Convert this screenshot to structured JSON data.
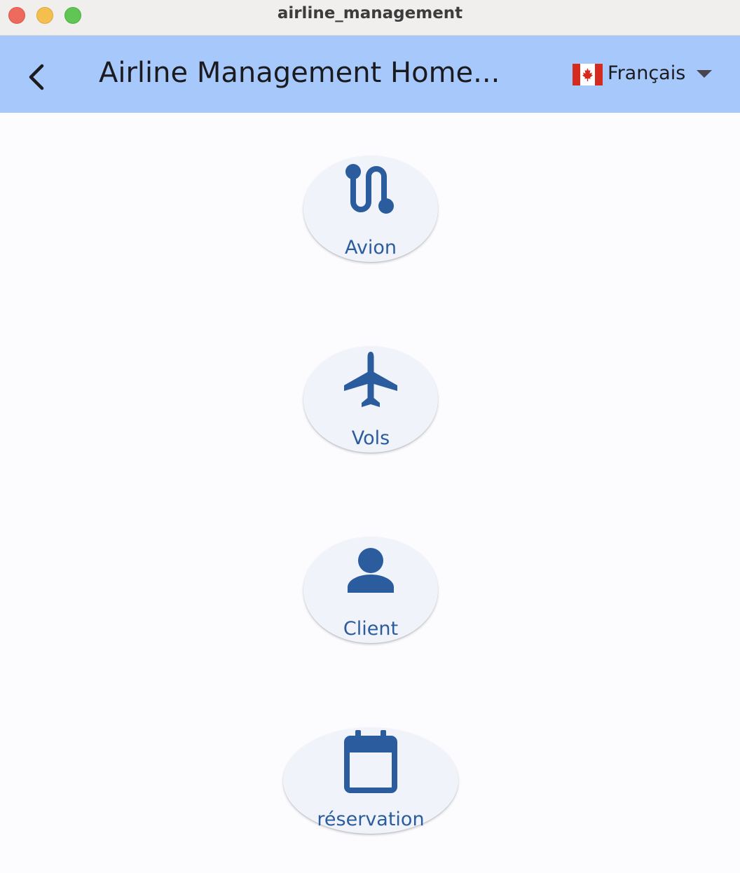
{
  "window": {
    "title": "airline_management"
  },
  "appbar": {
    "title": "Airline Management Home...",
    "language": {
      "label": "Français",
      "flag": "canada-flag-icon"
    }
  },
  "menu": {
    "items": [
      {
        "label": "Avion",
        "icon": "route-icon"
      },
      {
        "label": "Vols",
        "icon": "airplane-icon"
      },
      {
        "label": "Client",
        "icon": "person-icon"
      },
      {
        "label": "réservation",
        "icon": "calendar-icon"
      }
    ]
  },
  "colors": {
    "appbar_bg": "#a7c8fb",
    "accent": "#2b5c9e",
    "button_bg": "#f1f3fb",
    "page_bg": "#fcfcff"
  }
}
